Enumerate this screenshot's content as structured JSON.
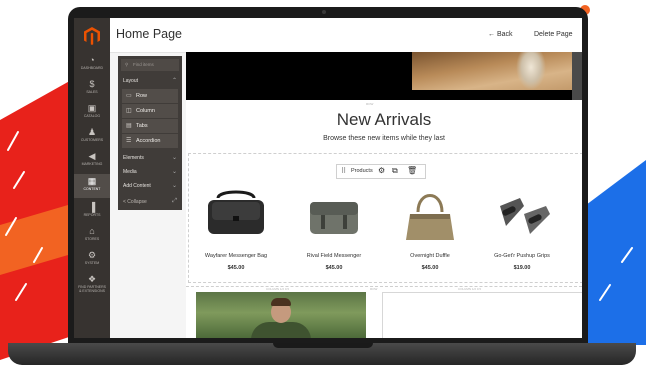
{
  "colors": {
    "accent": "#eb5202",
    "sidebar_bg": "#373330",
    "panel_bg": "#403c39",
    "stripe_red": "#e8221b",
    "stripe_orange": "#f26322",
    "stripe_blue": "#1c6fe8"
  },
  "header": {
    "title": "Home Page",
    "back_label": "← Back",
    "delete_label": "Delete Page"
  },
  "sidebar": {
    "logo_icon": "magento-logo-icon",
    "items": [
      {
        "label": "DASHBOARD",
        "icon": "gauge-icon",
        "glyph": "◔"
      },
      {
        "label": "SALES",
        "icon": "dollar-icon",
        "glyph": "$"
      },
      {
        "label": "CATALOG",
        "icon": "cube-icon",
        "glyph": "▣"
      },
      {
        "label": "CUSTOMERS",
        "icon": "person-icon",
        "glyph": "♟"
      },
      {
        "label": "MARKETING",
        "icon": "megaphone-icon",
        "glyph": "◀"
      },
      {
        "label": "CONTENT",
        "icon": "layout-icon",
        "glyph": "▦"
      },
      {
        "label": "REPORTS",
        "icon": "bar-chart-icon",
        "glyph": "▐"
      },
      {
        "label": "STORES",
        "icon": "store-icon",
        "glyph": "⌂"
      },
      {
        "label": "SYSTEM",
        "icon": "gear-icon",
        "glyph": "⚙"
      },
      {
        "label1": "FIND PARTNERS",
        "label2": "& EXTENSIONS",
        "icon": "cubes-icon",
        "glyph": "❖"
      }
    ]
  },
  "panel": {
    "search_placeholder": "Find items",
    "search_icon": "search-icon",
    "layout_label": "Layout",
    "layout_items": [
      {
        "label": "Row",
        "icon": "row-icon",
        "glyph": "▭"
      },
      {
        "label": "Column",
        "icon": "column-icon",
        "glyph": "◫"
      },
      {
        "label": "Tabs",
        "icon": "tabs-icon",
        "glyph": "▤"
      },
      {
        "label": "Accordion",
        "icon": "accordion-icon",
        "glyph": "☰"
      }
    ],
    "sections": [
      "Elements",
      "Media",
      "Add Content"
    ],
    "collapse_label": "< Collapse"
  },
  "stage": {
    "heading": "New Arrivals",
    "subheading": "Browse these new items while they last",
    "toolbar_label": "Products",
    "toolbar_icons": [
      "drag-handle-icon",
      "gear-icon",
      "copy-icon",
      "trash-icon"
    ],
    "row_tag": "ROW",
    "column_tag": "COLUMN 1/2 0.5",
    "column_tag_2": "COLUMN 1/2 0.5",
    "products": [
      {
        "name": "Wayfarer Messenger Bag",
        "price": "$45.00"
      },
      {
        "name": "Rival Field Messenger",
        "price": "$45.00"
      },
      {
        "name": "Overnight Duffle",
        "price": "$45.00"
      },
      {
        "name": "Go-Get'r Pushup Grips",
        "price": "$19.00"
      }
    ]
  }
}
